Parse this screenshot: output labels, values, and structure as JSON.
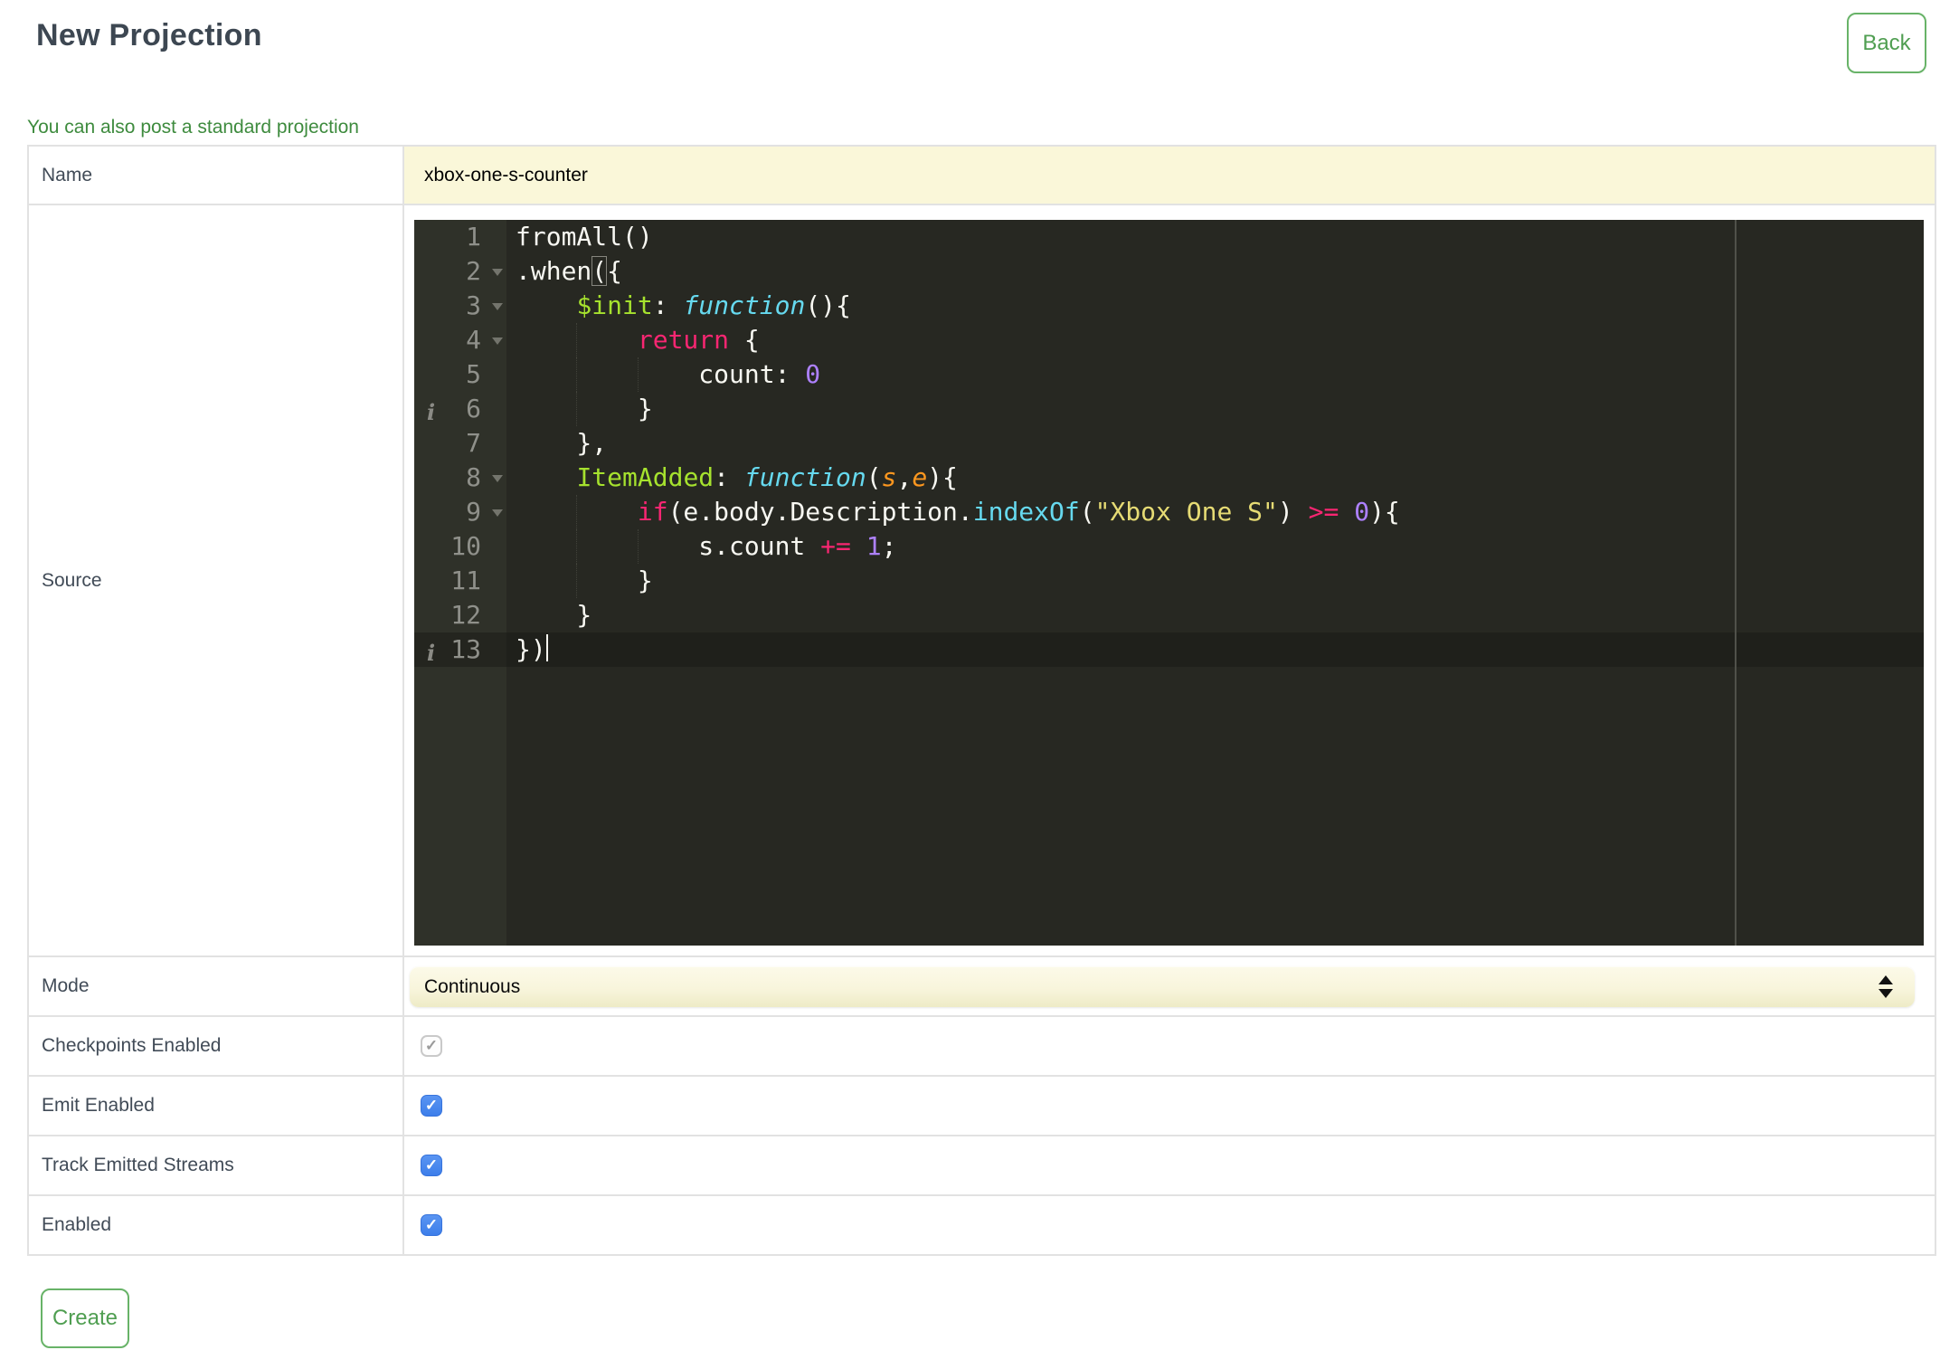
{
  "page": {
    "title": "New Projection",
    "back_label": "Back",
    "standard_projection_link": "You can also post a standard projection",
    "create_label": "Create"
  },
  "form": {
    "name_label": "Name",
    "name_value": "xbox-one-s-counter",
    "source_label": "Source",
    "mode_label": "Mode",
    "mode_value": "Continuous",
    "checkboxes": {
      "checkpoints": {
        "label": "Checkpoints Enabled",
        "checked": true,
        "disabled": true
      },
      "emit": {
        "label": "Emit Enabled",
        "checked": true,
        "disabled": false
      },
      "track": {
        "label": "Track Emitted Streams",
        "checked": true,
        "disabled": false
      },
      "enabled": {
        "label": "Enabled",
        "checked": true,
        "disabled": false
      }
    }
  },
  "ui": {
    "check_glyph": "✓",
    "colors": {
      "accent_green_text": "#4f9e51",
      "accent_green_border": "#68b368",
      "link_green": "#3e8b3e",
      "field_yellow": "#faf7d9",
      "checkbox_blue": "#4585ee",
      "title_color": "#3d4752",
      "table_border": "#e2e2e2"
    }
  },
  "editor": {
    "active_line": 13,
    "cursor_line": 13,
    "print_margin_column": 80,
    "colors": {
      "background": "#272822",
      "gutter": "#2f3129",
      "active_line": "#1f201b",
      "text": "#f8f8f2",
      "keyword": "#f92672",
      "declaration": "#a6e22e",
      "function_kw": "#66d9ef",
      "parameter": "#fd971f",
      "number": "#ae81ff",
      "string": "#e6db74",
      "line_number": "#8f908a"
    },
    "lines": [
      {
        "n": 1,
        "indent": 0,
        "tokens": [
          [
            "pl",
            "fromAll()"
          ]
        ]
      },
      {
        "n": 2,
        "indent": 0,
        "fold": true,
        "tokens": [
          [
            "pl",
            ".when"
          ],
          [
            "bm",
            "("
          ],
          [
            "pl",
            "{"
          ]
        ]
      },
      {
        "n": 3,
        "indent": 4,
        "fold": true,
        "tokens": [
          [
            "pl",
            "    "
          ],
          [
            "gr",
            "$init"
          ],
          [
            "pl",
            ": "
          ],
          [
            "fn",
            "function"
          ],
          [
            "pl",
            "(){"
          ]
        ]
      },
      {
        "n": 4,
        "indent": 8,
        "fold": true,
        "tokens": [
          [
            "pl",
            "        "
          ],
          [
            "kw",
            "return"
          ],
          [
            "pl",
            " {"
          ]
        ]
      },
      {
        "n": 5,
        "indent": 12,
        "tokens": [
          [
            "pl",
            "            count: "
          ],
          [
            "nu",
            "0"
          ]
        ]
      },
      {
        "n": 6,
        "indent": 8,
        "info": true,
        "tokens": [
          [
            "pl",
            "        }"
          ]
        ]
      },
      {
        "n": 7,
        "indent": 4,
        "tokens": [
          [
            "pl",
            "    },"
          ]
        ]
      },
      {
        "n": 8,
        "indent": 4,
        "fold": true,
        "tokens": [
          [
            "pl",
            "    "
          ],
          [
            "gr",
            "ItemAdded"
          ],
          [
            "pl",
            ": "
          ],
          [
            "fn",
            "function"
          ],
          [
            "pl",
            "("
          ],
          [
            "pa",
            "s"
          ],
          [
            "pl",
            ","
          ],
          [
            "pa",
            "e"
          ],
          [
            "pl",
            "){"
          ]
        ]
      },
      {
        "n": 9,
        "indent": 8,
        "fold": true,
        "tokens": [
          [
            "pl",
            "        "
          ],
          [
            "kw",
            "if"
          ],
          [
            "pl",
            "(e.body.Description."
          ],
          [
            "cy",
            "indexOf"
          ],
          [
            "pl",
            "("
          ],
          [
            "st",
            "\"Xbox One S\""
          ],
          [
            "pl",
            ") "
          ],
          [
            "kw",
            ">="
          ],
          [
            "pl",
            " "
          ],
          [
            "nu",
            "0"
          ],
          [
            "pl",
            "){"
          ]
        ]
      },
      {
        "n": 10,
        "indent": 12,
        "tokens": [
          [
            "pl",
            "            s.count "
          ],
          [
            "kw",
            "+="
          ],
          [
            "pl",
            " "
          ],
          [
            "nu",
            "1"
          ],
          [
            "pl",
            ";"
          ]
        ]
      },
      {
        "n": 11,
        "indent": 8,
        "tokens": [
          [
            "pl",
            "        }"
          ]
        ]
      },
      {
        "n": 12,
        "indent": 4,
        "tokens": [
          [
            "pl",
            "    }"
          ]
        ]
      },
      {
        "n": 13,
        "indent": 0,
        "info": true,
        "tokens": [
          [
            "pl",
            "})"
          ]
        ]
      }
    ]
  }
}
